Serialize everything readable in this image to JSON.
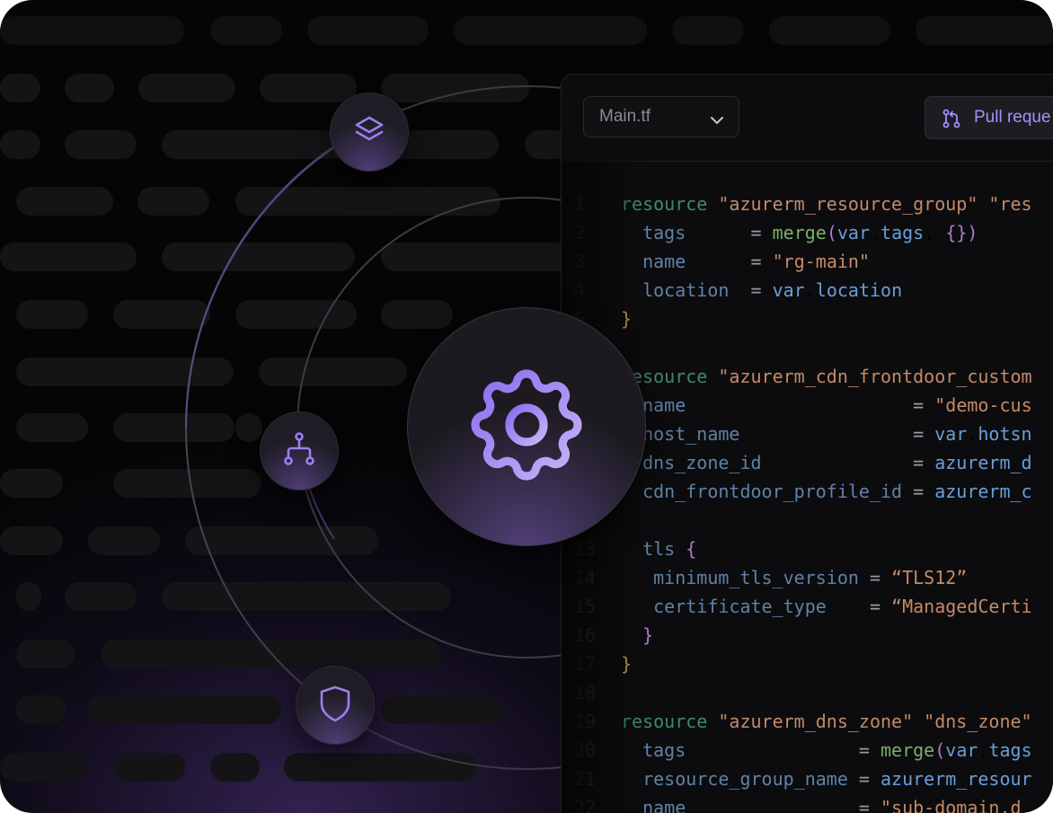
{
  "editor": {
    "file_select": {
      "value": "Main.tf",
      "icon": "chevron-down-icon"
    },
    "pull_request_button": {
      "label": "Pull reque",
      "icon": "git-pull-request-icon",
      "color": "#a590ff"
    },
    "lines": [
      {
        "n": "1",
        "code": "resource \"azurerm_resource_group\" \"res"
      },
      {
        "n": "2",
        "code": "  tags      = merge(var.tags, {})"
      },
      {
        "n": "3",
        "code": "  name      = \"rg-main\""
      },
      {
        "n": "4",
        "code": "  location  = var.location"
      },
      {
        "n": "5",
        "code": "}"
      },
      {
        "n": "",
        "code": ""
      },
      {
        "n": "",
        "code": "resource \"azurerm_cdn_frontdoor_custom"
      },
      {
        "n": "",
        "code": "  name                     = \"demo-cus"
      },
      {
        "n": "",
        "code": "  host_name                = var.hotsn"
      },
      {
        "n": "",
        "code": "  dns_zone_id              = azurerm_d"
      },
      {
        "n": "",
        "code": "  cdn_frontdoor_profile_id = azurerm_c"
      },
      {
        "n": "",
        "code": ""
      },
      {
        "n": "13",
        "code": "  tls {"
      },
      {
        "n": "14",
        "code": "   minimum_tls_version = “TLS12”"
      },
      {
        "n": "15",
        "code": "   certificate_type    = “ManagedCerti"
      },
      {
        "n": "16",
        "code": "  }"
      },
      {
        "n": "17",
        "code": "}"
      },
      {
        "n": "18",
        "code": ""
      },
      {
        "n": "19",
        "code": "resource \"azurerm_dns_zone\" \"dns_zone\""
      },
      {
        "n": "20",
        "code": "  tags                = merge(var.tags"
      },
      {
        "n": "21",
        "code": "  resource_group_name = azurerm_resour"
      },
      {
        "n": "22",
        "code": "  name                = \"sub-domain.d"
      }
    ]
  },
  "orbit_nodes": [
    {
      "icon": "layers-icon"
    },
    {
      "icon": "hierarchy-icon"
    },
    {
      "icon": "shield-icon"
    },
    {
      "icon": "gear-icon"
    }
  ],
  "colors": {
    "accent": "#9b7ff0",
    "background": "#050506",
    "panel": "#0c0c0e"
  }
}
